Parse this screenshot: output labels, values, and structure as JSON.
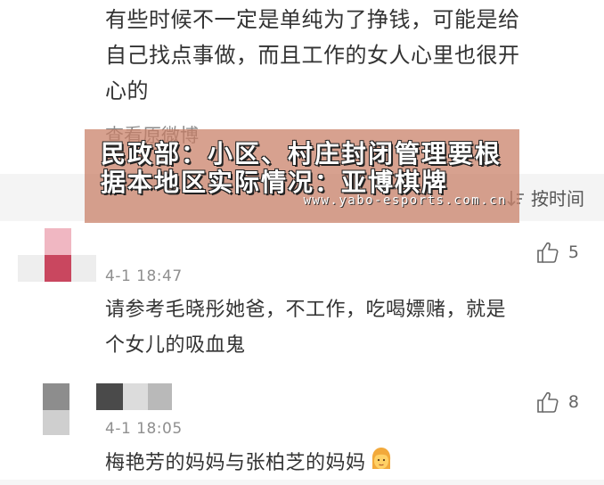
{
  "post": {
    "text_line1": "有些时候不一定是单纯为了挣钱，可能是给",
    "text_line2": "自己找点事做，而且工作的女人心里也很开",
    "text_line3": "心的",
    "view_original": "查看原微博"
  },
  "sort": {
    "label": "按时间"
  },
  "watermark": {
    "line1": "民政部：小区、村庄封闭管理要根",
    "line2": "据本地区实际情况：亚博棋牌",
    "url": "www.yabo-esports.com.cn"
  },
  "comments": [
    {
      "likes": "5",
      "time": "4-1 18:47",
      "line1": "请参考毛晓彤她爸，不工作，吃喝嫖赌，就是",
      "line2": "个女儿的吸血鬼"
    },
    {
      "likes": "8",
      "time": "4-1 18:05",
      "line1": "梅艳芳的妈妈与张柏芝的妈妈",
      "emoji": "woman-face-emoji"
    }
  ]
}
